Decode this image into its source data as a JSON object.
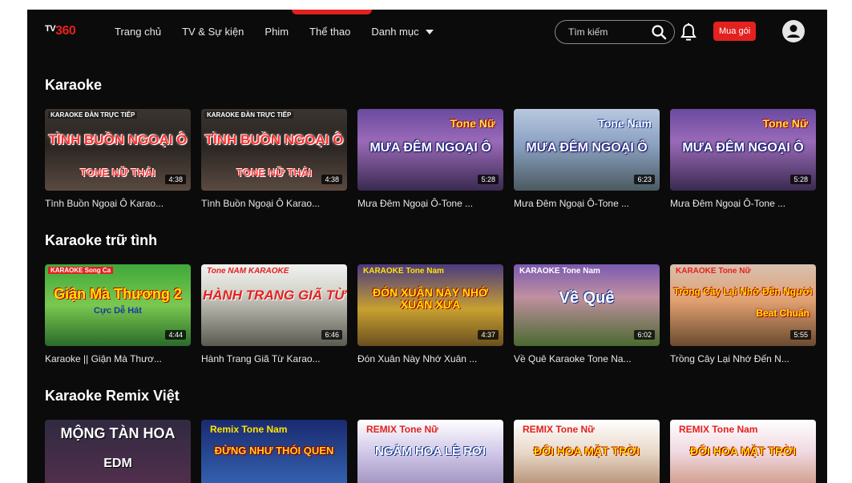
{
  "header": {
    "logo_tv": "TV",
    "logo_num": "360",
    "nav": [
      "Trang chủ",
      "TV & Sự kiện",
      "Phim",
      "Thể thao"
    ],
    "categories": "Danh mục",
    "search_placeholder": "Tìm kiếm",
    "buy_label": "Mua gói"
  },
  "colors": {
    "brand": "#e3211f",
    "background": "#0b0b0b"
  },
  "sections": [
    {
      "title": "Karaoke",
      "items": [
        {
          "top": "KARAOKE ĐÀN TRỰC TIẾP",
          "big": "TÌNH BUỒN NGOẠI Ô",
          "small": "TONE NỮ THÁI",
          "tone": "",
          "duration": "4:38",
          "caption": "Tình Buồn Ngoại Ô Karao..."
        },
        {
          "top": "KARAOKE ĐÀN TRỰC TIẾP",
          "big": "TÌNH BUỒN NGOẠI Ô",
          "small": "TONE NỮ THÁI",
          "tone": "",
          "duration": "4:38",
          "caption": "Tình Buồn Ngoại Ô Karao..."
        },
        {
          "top": "",
          "big": "MƯA ĐÊM NGOẠI Ô",
          "small": "",
          "tone": "Tone Nữ",
          "duration": "5:28",
          "caption": "Mưa Đêm Ngoại Ô-Tone ..."
        },
        {
          "top": "",
          "big": "MƯA ĐÊM NGOẠI Ô",
          "small": "",
          "tone": "Tone Nam",
          "duration": "6:23",
          "caption": "Mưa Đêm Ngoại Ô-Tone ..."
        },
        {
          "top": "",
          "big": "MƯA ĐÊM NGOẠI Ô",
          "small": "",
          "tone": "Tone Nữ",
          "duration": "5:28",
          "caption": "Mưa Đêm Ngoại Ô-Tone ..."
        }
      ]
    },
    {
      "title": "Karaoke trữ tình",
      "items": [
        {
          "top": "KARAOKE Song Ca",
          "big": "Giận Mà Thương 2",
          "small": "Cực Dễ Hát",
          "tone": "",
          "duration": "4:44",
          "caption": "Karaoke || Giận Mà Thươ..."
        },
        {
          "top": "Tone NAM KARAOKE",
          "big": "HÀNH TRANG GIÃ TỪ",
          "small": "",
          "tone": "",
          "duration": "6:46",
          "caption": "Hành Trang Giã Từ Karao..."
        },
        {
          "top": "KARAOKE Tone Nam",
          "big": "ĐÓN XUÂN NÀY NHỚ XUÂN XƯA",
          "small": "",
          "tone": "",
          "duration": "4:37",
          "caption": "Đón Xuân Này Nhớ Xuân ..."
        },
        {
          "top": "KARAOKE Tone Nam",
          "big": "Về Quê",
          "small": "",
          "tone": "",
          "duration": "6:02",
          "caption": "Về Quê Karaoke Tone Na..."
        },
        {
          "top": "KARAOKE Tone Nữ",
          "big": "Trồng Cây Lại Nhớ Đến Người",
          "small": "Beat Chuẩn",
          "tone": "",
          "duration": "5:55",
          "caption": "Trồng Cây Lại Nhớ Đến N..."
        }
      ]
    },
    {
      "title": "Karaoke Remix Việt",
      "items": [
        {
          "top": "",
          "big": "MỘNG TÀN HOA",
          "small": "EDM",
          "tone": "",
          "duration": "",
          "caption": ""
        },
        {
          "top": "Remix Tone Nam",
          "big": "ĐỪNG NHƯ THÓI QUEN",
          "small": "",
          "tone": "",
          "duration": "",
          "caption": ""
        },
        {
          "top": "REMIX   Tone Nữ",
          "big": "NGẮM HOA LỆ RƠI",
          "small": "",
          "tone": "",
          "duration": "",
          "caption": ""
        },
        {
          "top": "REMIX   Tone Nữ",
          "big": "ĐỔI HOA MẶT TRỜI",
          "small": "",
          "tone": "",
          "duration": "",
          "caption": ""
        },
        {
          "top": "REMIX   Tone Nam",
          "big": "ĐỔI HOA MẶT TRỜI",
          "small": "",
          "tone": "",
          "duration": "",
          "caption": ""
        }
      ]
    }
  ]
}
